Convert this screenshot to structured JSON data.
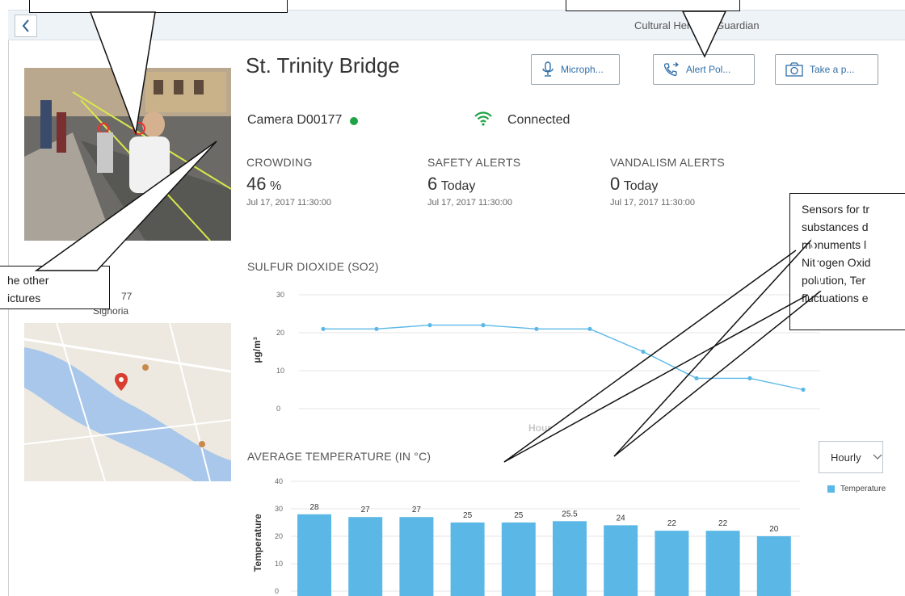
{
  "app": {
    "title": "Cultural Heritage Guardian"
  },
  "monument": {
    "name": "St. Trinity Bridge"
  },
  "toolbar": {
    "microphone_label": "Microph...",
    "alert_label": "Alert Pol...",
    "photo_label": "Take a p..."
  },
  "camera": {
    "label": "Camera D00177",
    "status_color": "#1ea445",
    "connection": "Connected",
    "connection_color": "#1ea445"
  },
  "kpis": [
    {
      "title": "CROWDING",
      "value": "46",
      "unit": "%",
      "time": "Jul 17, 2017 11:30:00"
    },
    {
      "title": "SAFETY ALERTS",
      "value": "6",
      "unit": "Today",
      "time": "Jul 17, 2017 11:30:00"
    },
    {
      "title": "VANDALISM ALERTS",
      "value": "0",
      "unit": "Today",
      "time": "Jul 17, 2017 11:30:00"
    }
  ],
  "side": {
    "caption_line1": "77",
    "caption_line2": "Signoria"
  },
  "sections": {
    "so2_title": "SULFUR DIOXIDE (SO2)",
    "temp_title": "AVERAGE TEMPERATURE (IN °C)"
  },
  "controls": {
    "interval_value": "Hourly",
    "legend_label": "Temperature"
  },
  "callouts": {
    "top_right": "",
    "left_line1": "he  other",
    "left_line2": "ictures",
    "right_lines": [
      "Sensors for tr",
      "substances d",
      "monuments l",
      "Nitrogen Oxid",
      "pollution, Ter",
      "fluctuations e"
    ]
  },
  "chart_data": [
    {
      "type": "line",
      "title": "SULFUR DIOXIDE (SO2)",
      "xlabel": "Hour",
      "ylabel": "µg/m³",
      "ylim": [
        0,
        30
      ],
      "yticks": [
        0,
        10,
        20,
        30
      ],
      "grid": true,
      "color": "#5bb8e6",
      "series": [
        {
          "values": [
            21,
            21,
            22,
            22,
            21,
            21,
            15,
            8,
            8,
            5
          ]
        }
      ]
    },
    {
      "type": "bar",
      "title": "AVERAGE TEMPERATURE (IN °C)",
      "xlabel": "",
      "ylabel": "Temperature",
      "ylim": [
        0,
        40
      ],
      "yticks": [
        0,
        10,
        20,
        30,
        40
      ],
      "grid": true,
      "legend": "right",
      "color": "#5bb8e6",
      "series": [
        {
          "name": "Temperature",
          "values": [
            28,
            27,
            27,
            25,
            25,
            25.5,
            24,
            22,
            22,
            20
          ]
        }
      ]
    }
  ]
}
